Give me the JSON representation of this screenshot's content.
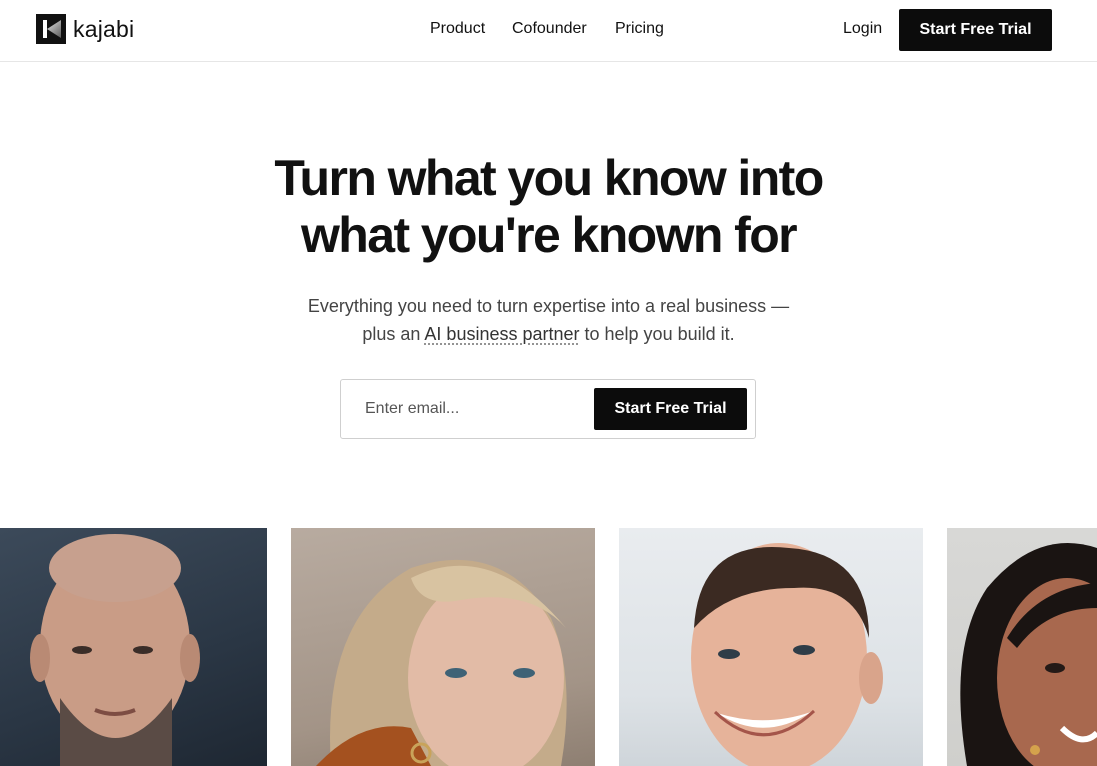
{
  "brand": {
    "name": "kajabi"
  },
  "nav": {
    "links": [
      "Product",
      "Cofounder",
      "Pricing"
    ],
    "login": "Login",
    "cta": "Start Free Trial"
  },
  "hero": {
    "title_line1": "Turn what you know into",
    "title_line2": "what you're known for",
    "sub_line1": "Everything you need to turn expertise into a real business —",
    "sub_line2_before": "plus an ",
    "sub_line2_link": "AI business partner",
    "sub_line2_after": " to help you build it.",
    "email_placeholder": "Enter email...",
    "email_cta": "Start Free Trial"
  },
  "colors": {
    "primary": "#0c0c0c",
    "text": "#111111",
    "subtext": "#444444"
  }
}
